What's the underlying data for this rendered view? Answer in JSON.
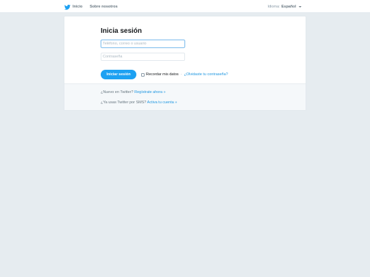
{
  "topbar": {
    "home_label": "Inicio",
    "about_label": "Sobre nosotros",
    "language_prefix": "Idioma:",
    "language_value": "Español"
  },
  "login": {
    "title": "Inicia sesión",
    "username_placeholder": "Teléfono, correo o usuario",
    "username_value": "",
    "password_placeholder": "Contraseña",
    "password_value": "",
    "submit_label": "Iniciar sesión",
    "remember_label": "Recordar mis datos",
    "separator": "·",
    "forgot_label": "¿Olvidaste tu contraseña?"
  },
  "footer": {
    "signup_prefix": "¿Nuevo en Twitter?",
    "signup_link": "Regístrate ahora »",
    "sms_prefix": "¿Ya usas Twitter por SMS?",
    "sms_link": "Activa tu cuenta »"
  },
  "colors": {
    "brand": "#1da1f2",
    "link": "#1b95e0",
    "background": "#e6ecf0"
  },
  "icons": {
    "brand": "twitter-bird-icon",
    "language_dropdown": "caret-down-icon"
  }
}
